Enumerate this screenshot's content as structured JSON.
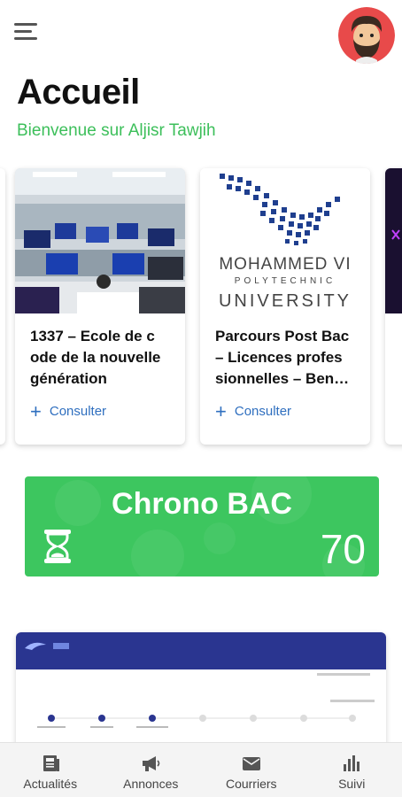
{
  "header": {
    "title": "Accueil",
    "subtitle": "Bienvenue sur Aljisr Tawjih"
  },
  "cards": [
    {
      "title": "1337 – Ecole de c ode de la nouvelle génération",
      "action": "Consulter",
      "image": "computer-lab-photo"
    },
    {
      "title": "Parcours Post Bac – Licences profes sionnelles – Ben…",
      "action": "Consulter",
      "image": "university-logo",
      "logo_text": {
        "line1": "MOHAMMED VI",
        "line2": "POLYTECHNIC",
        "line3": "UNIVERSITY"
      }
    }
  ],
  "chrono": {
    "title": "Chrono BAC",
    "value": "70",
    "icon": "hourglass-icon"
  },
  "bottom_nav": [
    {
      "label": "Actualités",
      "icon": "newspaper-icon"
    },
    {
      "label": "Annonces",
      "icon": "megaphone-icon"
    },
    {
      "label": "Courriers",
      "icon": "envelope-icon"
    },
    {
      "label": "Suivi",
      "icon": "bar-chart-icon"
    }
  ],
  "colors": {
    "accent_green": "#3dc65f",
    "subtitle_green": "#3cbf5a",
    "link_blue": "#2f6fbf",
    "banner_navy": "#2a3590"
  }
}
